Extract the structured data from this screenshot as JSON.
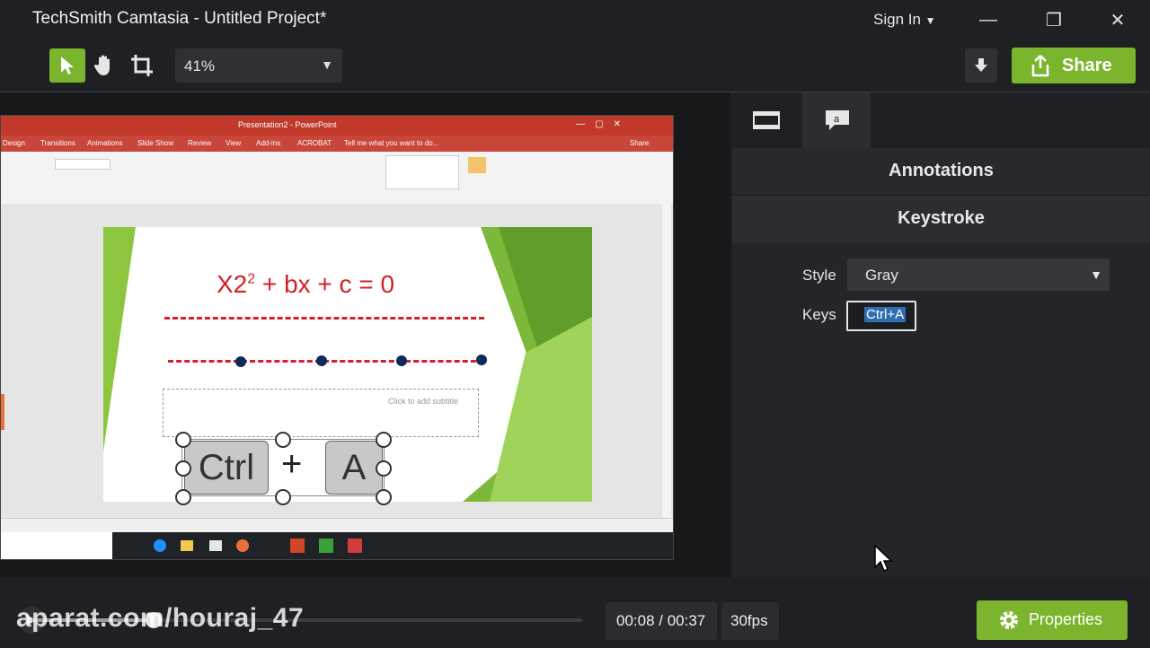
{
  "window": {
    "title": "TechSmith Camtasia - Untitled Project*",
    "sign_in": "Sign In",
    "min_glyph": "—",
    "restore_glyph": "❐",
    "close_glyph": "✕"
  },
  "toolbar": {
    "zoom": "41%",
    "share_label": "Share"
  },
  "recording": {
    "app_window_title": "Presentation2 - PowerPoint",
    "equation_main": "X2",
    "equation_sup": "2",
    "equation_rest": " + bx + c = 0",
    "subtitle_placeholder": "Click to add subtitle",
    "ribbon_tabs": [
      "Design",
      "Transitions",
      "Animations",
      "Slide Show",
      "Review",
      "View",
      "Add-ins",
      "ACROBAT",
      "Tell me what you want to do..."
    ],
    "share_tab": "Share",
    "keys": [
      "Ctrl",
      "A"
    ],
    "plus": "+"
  },
  "panel": {
    "annotations_title": "Annotations",
    "keystroke_title": "Keystroke",
    "style_label": "Style",
    "style_value": "Gray",
    "keys_label": "Keys",
    "keys_value": "Ctrl+A"
  },
  "playback": {
    "time": "00:08 / 00:37",
    "fps": "30fps",
    "progress": 0.22,
    "properties_label": "Properties"
  },
  "watermark": "aparat.com/houraj_47",
  "colors": {
    "accent_green": "#7bb52d",
    "background": "#1d1e21",
    "equation_red": "#d32028"
  }
}
